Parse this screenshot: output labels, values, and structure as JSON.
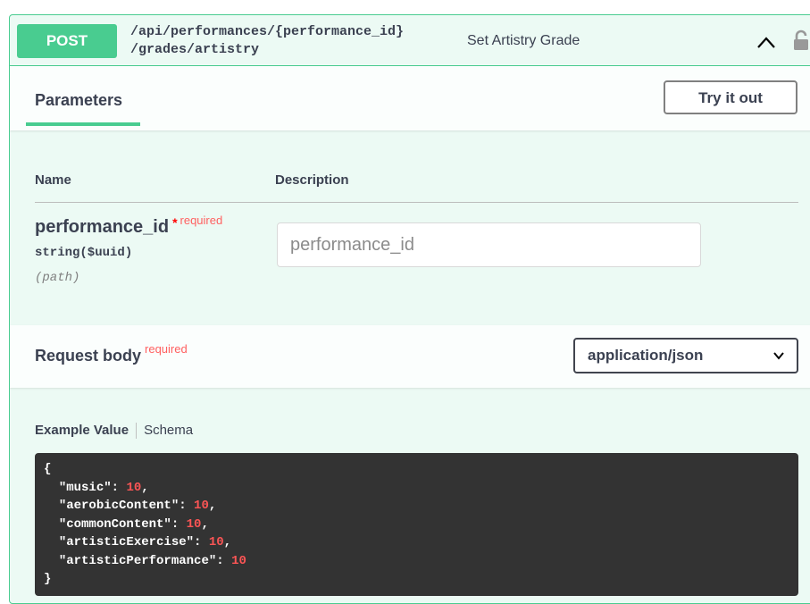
{
  "operation": {
    "method": "POST",
    "path_line1": "/api/performances/{performance_id}",
    "path_line2": "/grades/artistry",
    "summary": "Set Artistry Grade"
  },
  "parameters": {
    "tab_label": "Parameters",
    "try_it_out_label": "Try it out",
    "col_name": "Name",
    "col_description": "Description",
    "items": [
      {
        "name": "performance_id",
        "required_star": "*",
        "required_label": "required",
        "type": "string($uuid)",
        "in": "(path)",
        "placeholder": "performance_id"
      }
    ]
  },
  "request_body": {
    "title": "Request body",
    "required_label": "required",
    "content_type": "application/json",
    "example_tab": "Example Value",
    "schema_tab": "Schema",
    "example": {
      "open": "{",
      "close": "}",
      "fields": [
        {
          "key": "\"music\"",
          "value": "10",
          "trail": ","
        },
        {
          "key": "\"aerobicContent\"",
          "value": "10",
          "trail": ","
        },
        {
          "key": "\"commonContent\"",
          "value": "10",
          "trail": ","
        },
        {
          "key": "\"artisticExercise\"",
          "value": "10",
          "trail": ","
        },
        {
          "key": "\"artisticPerformance\"",
          "value": "10",
          "trail": ""
        }
      ]
    }
  },
  "colors": {
    "post_green": "#49cc90",
    "required_red": "#ff6060",
    "code_bg": "#333333",
    "code_number": "#fc5555"
  },
  "icons": [
    "chevron-up-icon",
    "unlock-icon",
    "chevron-down-icon"
  ]
}
